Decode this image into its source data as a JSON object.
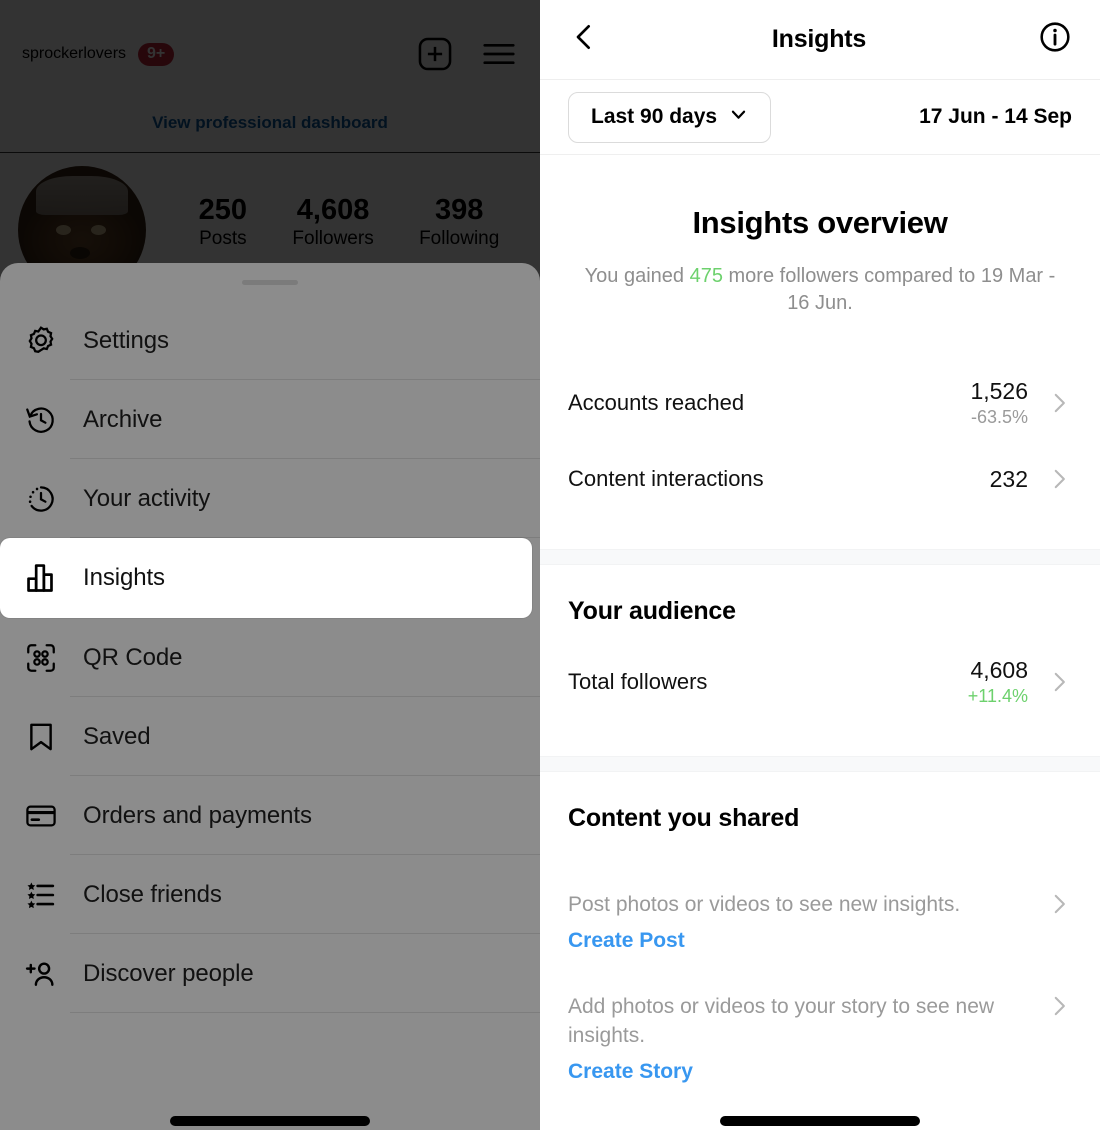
{
  "left_panel": {
    "profile": {
      "username": "sprockerlovers",
      "notification_badge": "9+",
      "professional_dashboard_link": "View professional dashboard",
      "avatar_name": "profile-avatar",
      "stats": [
        {
          "value": "250",
          "label": "Posts"
        },
        {
          "value": "4,608",
          "label": "Followers"
        },
        {
          "value": "398",
          "label": "Following"
        }
      ],
      "header_icons": [
        {
          "name": "new-post-icon"
        },
        {
          "name": "hamburger-menu-icon"
        }
      ]
    },
    "menu": {
      "items": [
        {
          "label": "Settings",
          "icon": "settings-gear-icon",
          "selected": false
        },
        {
          "label": "Archive",
          "icon": "archive-clock-icon",
          "selected": false
        },
        {
          "label": "Your activity",
          "icon": "activity-clock-icon",
          "selected": false
        },
        {
          "label": "Insights",
          "icon": "insights-bar-chart-icon",
          "selected": true
        },
        {
          "label": "QR Code",
          "icon": "qr-code-icon",
          "selected": false
        },
        {
          "label": "Saved",
          "icon": "bookmark-icon",
          "selected": false
        },
        {
          "label": "Orders and payments",
          "icon": "credit-card-icon",
          "selected": false
        },
        {
          "label": "Close friends",
          "icon": "close-friends-list-icon",
          "selected": false
        },
        {
          "label": "Discover people",
          "icon": "add-person-icon",
          "selected": false
        }
      ]
    }
  },
  "right_panel": {
    "header": {
      "back_icon": "back-chevron-icon",
      "title": "Insights",
      "info_icon": "info-circle-icon"
    },
    "range": {
      "selector_label": "Last 90 days",
      "chevron_icon": "chevron-down-icon",
      "dates": "17 Jun - 14 Sep"
    },
    "overview": {
      "title": "Insights overview",
      "subtitle_prefix": "You gained ",
      "subtitle_highlight": "475",
      "subtitle_suffix": " more followers compared to 19 Mar - 16 Jun.",
      "highlight_color": "#6DD16D",
      "metrics": [
        {
          "label": "Accounts reached",
          "value": "1,526",
          "delta": "-63.5%",
          "delta_dir": "neg"
        },
        {
          "label": "Content interactions",
          "value": "232",
          "delta": "",
          "delta_dir": "none"
        }
      ]
    },
    "audience": {
      "title": "Your audience",
      "metrics": [
        {
          "label": "Total followers",
          "value": "4,608",
          "delta": "+11.4%",
          "delta_dir": "pos"
        }
      ]
    },
    "content_shared": {
      "title": "Content you shared",
      "rows": [
        {
          "text": "Post photos or videos to see new insights.",
          "cta": "Create Post"
        },
        {
          "text": "Add photos or videos to your story to see new insights.",
          "cta": "Create Story"
        }
      ]
    }
  }
}
